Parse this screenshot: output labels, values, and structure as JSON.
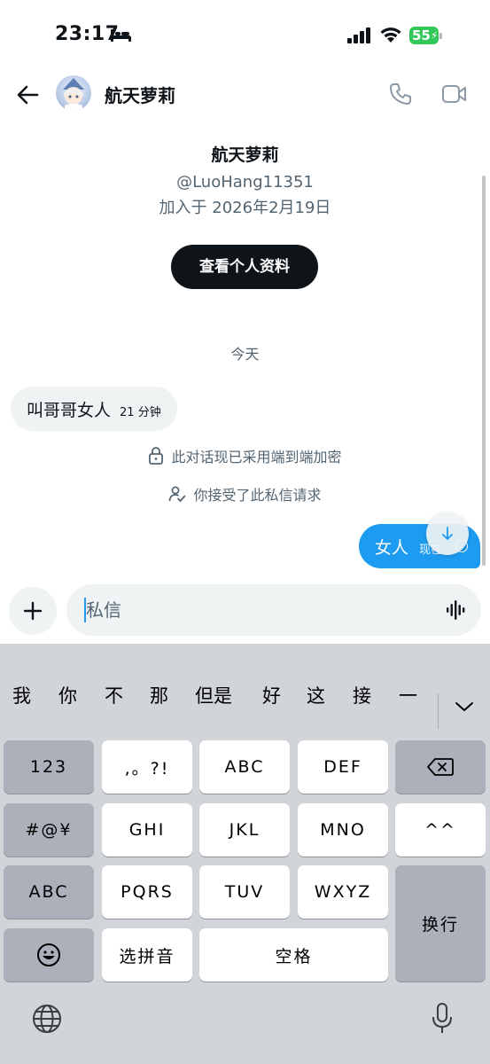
{
  "status_bar": {
    "time": "23:17",
    "battery": "55"
  },
  "header": {
    "name": "航天萝莉"
  },
  "profile": {
    "name": "航天萝莉",
    "handle": "@LuoHang11351",
    "joined": "加入于 2026年2月19日",
    "view_profile_label": "查看个人资料"
  },
  "conversation": {
    "date_divider": "今天",
    "incoming": {
      "text": "叫哥哥女人",
      "time": "21 分钟"
    },
    "encryption_notice": "此对话现已采用端到端加密",
    "accepted_notice": "你接受了此私信请求",
    "outgoing": {
      "text": "女人",
      "time": "现在"
    }
  },
  "composer": {
    "placeholder": "私信"
  },
  "keyboard": {
    "candidates": [
      "我",
      "你",
      "不",
      "那",
      "但是",
      "好",
      "这",
      "接",
      "一"
    ],
    "keys": {
      "num": "123",
      "punct": ",。?!",
      "abc": "ABC",
      "def": "DEF",
      "symbols": "#@¥",
      "ghi": "GHI",
      "jkl": "JKL",
      "mno": "MNO",
      "emoticon": "^^",
      "abc_switch": "ABC",
      "pqrs": "PQRS",
      "tuv": "TUV",
      "wxyz": "WXYZ",
      "return": "换行",
      "pinyin": "选拼音",
      "space": "空格"
    }
  },
  "icons": {
    "back": "back-arrow-icon",
    "phone": "phone-icon",
    "video": "video-camera-icon",
    "lock": "lock-icon",
    "person-check": "person-check-icon",
    "scroll-down": "arrow-down-icon",
    "add": "plus-icon",
    "voice": "waveform-icon",
    "delete": "backspace-icon",
    "emoji": "emoji-icon",
    "globe": "globe-icon",
    "mic": "microphone-icon",
    "collapse": "chevron-down-icon"
  },
  "colors": {
    "accent": "#1d9bf0",
    "text_primary": "#0f1419",
    "text_secondary": "#536471",
    "bubble_incoming": "#eff3f4",
    "keyboard_bg": "#d1d4d9"
  }
}
